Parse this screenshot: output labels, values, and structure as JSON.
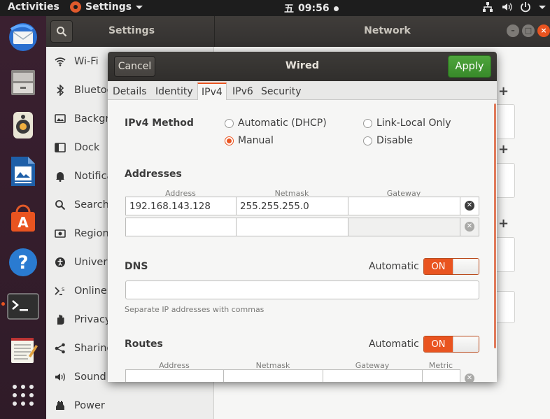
{
  "topbar": {
    "activities": "Activities",
    "app_menu": "Settings",
    "clock_prefix": "五",
    "clock_time": "09:56"
  },
  "settings": {
    "header_title": "Settings",
    "pane_title": "Network",
    "window_buttons": [
      "–",
      "□",
      "×"
    ],
    "sidebar": [
      {
        "label": "Wi-Fi",
        "icon": "wifi-icon"
      },
      {
        "label": "Bluetooth",
        "icon": "bluetooth-icon"
      },
      {
        "label": "Background",
        "icon": "background-icon"
      },
      {
        "label": "Dock",
        "icon": "dock-icon"
      },
      {
        "label": "Notifications",
        "icon": "bell-icon"
      },
      {
        "label": "Search",
        "icon": "search-icon"
      },
      {
        "label": "Region & Language",
        "icon": "region-icon"
      },
      {
        "label": "Universal Access",
        "icon": "universal-access-icon"
      },
      {
        "label": "Online Accounts",
        "icon": "online-accounts-icon"
      },
      {
        "label": "Privacy",
        "icon": "privacy-icon"
      },
      {
        "label": "Sharing",
        "icon": "share-icon"
      },
      {
        "label": "Sound",
        "icon": "sound-icon"
      },
      {
        "label": "Power",
        "icon": "power-icon"
      }
    ]
  },
  "dialog": {
    "title": "Wired",
    "cancel_label": "Cancel",
    "apply_label": "Apply",
    "tabs": [
      "Details",
      "Identity",
      "IPv4",
      "IPv6",
      "Security"
    ],
    "active_tab": "IPv4",
    "ipv4_method_label": "IPv4 Method",
    "methods": {
      "automatic": "Automatic (DHCP)",
      "link_local": "Link-Local Only",
      "manual": "Manual",
      "disable": "Disable"
    },
    "selected_method": "Manual",
    "addresses_label": "Addresses",
    "address_columns": [
      "Address",
      "Netmask",
      "Gateway"
    ],
    "address_rows": [
      {
        "address": "192.168.143.128",
        "netmask": "255.255.255.0",
        "gateway": ""
      },
      {
        "address": "",
        "netmask": "",
        "gateway": ""
      }
    ],
    "dns_label": "DNS",
    "dns_automatic_label": "Automatic",
    "dns_toggle": "ON",
    "dns_value": "",
    "dns_hint": "Separate IP addresses with commas",
    "routes_label": "Routes",
    "routes_automatic_label": "Automatic",
    "routes_toggle": "ON",
    "route_columns": [
      "Address",
      "Netmask",
      "Gateway",
      "Metric"
    ]
  },
  "colors": {
    "accent": "#e95420",
    "apply_green": "#3e9a30",
    "dock_bg": "#351e2d",
    "topbar_bg": "#1d1d1d"
  }
}
